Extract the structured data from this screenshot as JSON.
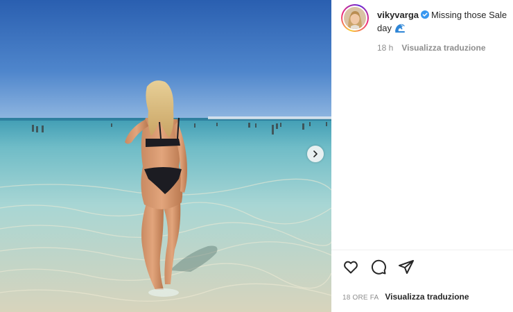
{
  "post": {
    "username": "vikyvarga",
    "caption": "Missing those Sale day",
    "caption_emoji": "wave-emoji",
    "time_relative": "18 h",
    "see_translation": "Visualizza traduzione",
    "time_caps": "18 ORE FA",
    "see_translation_footer": "Visualizza traduzione"
  },
  "icons": {
    "verified": "verified-badge-icon",
    "next": "chevron-right-icon",
    "like": "heart-icon",
    "comment": "comment-icon",
    "share": "send-icon"
  },
  "colors": {
    "verified_blue": "#3897f0",
    "text": "#262626",
    "secondary_text": "#8e8e8e",
    "divider": "#efefef"
  }
}
